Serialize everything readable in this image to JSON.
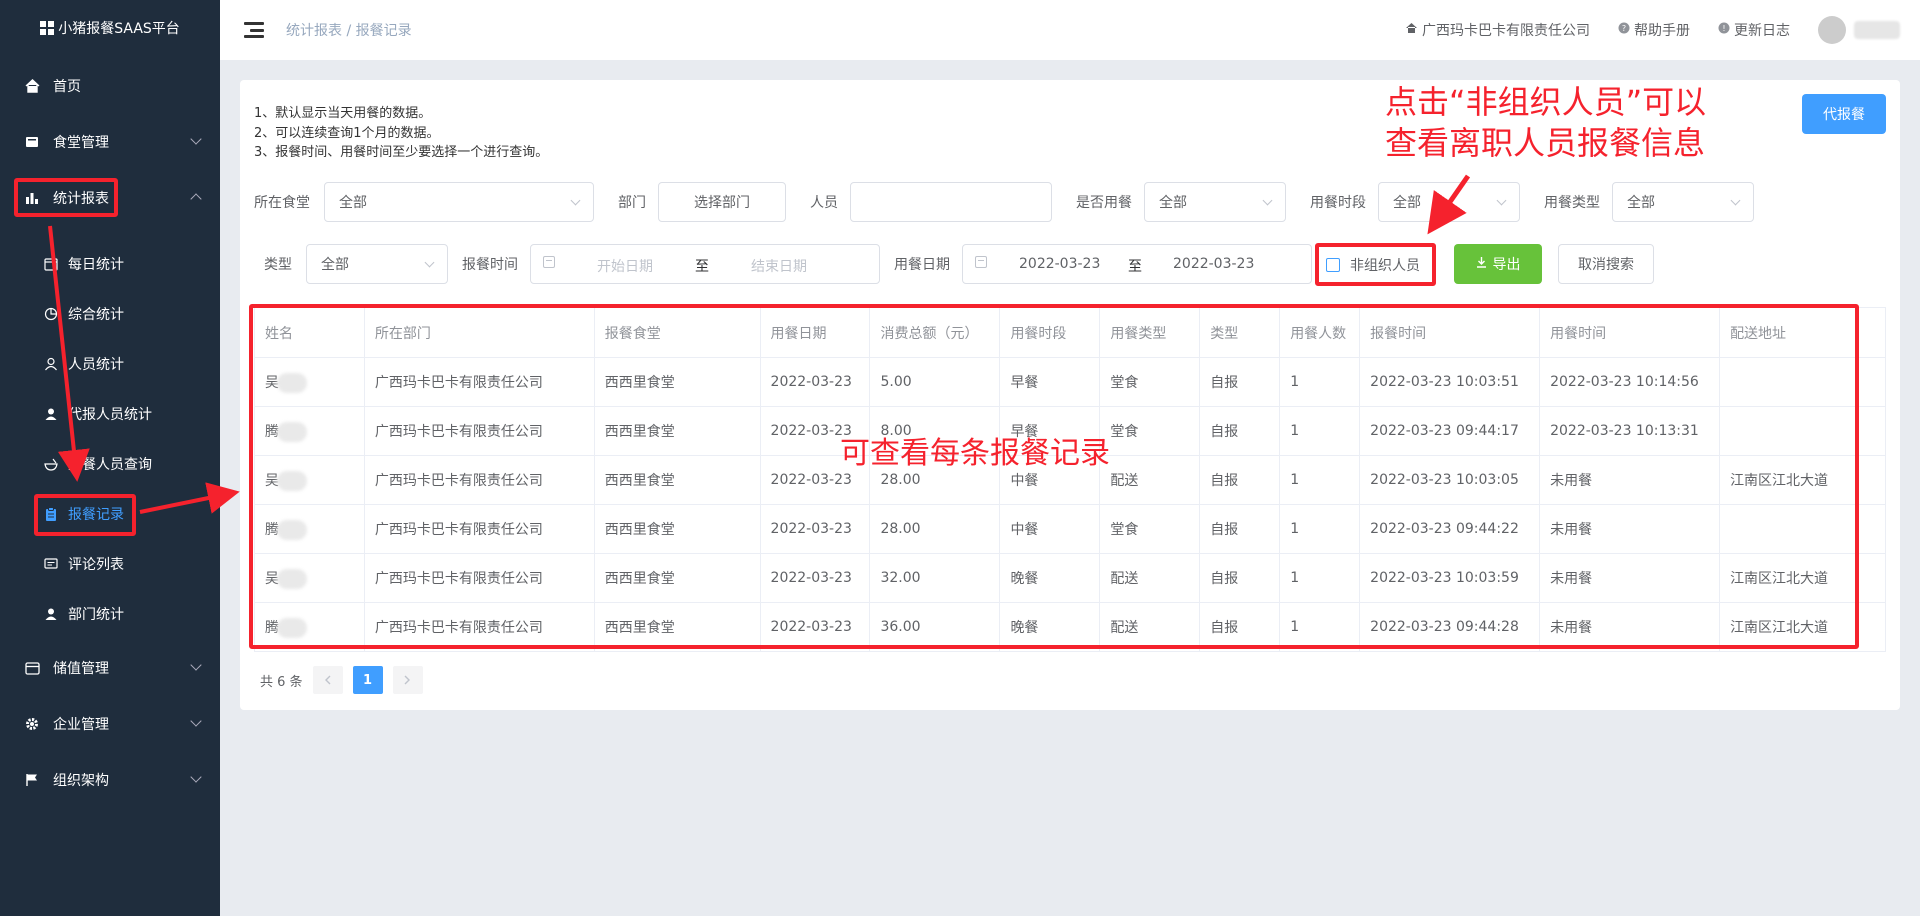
{
  "app": {
    "title": "小猪报餐SAAS平台"
  },
  "sidebar": {
    "items": [
      {
        "label": "首页",
        "icon": "home-icon"
      },
      {
        "label": "食堂管理",
        "icon": "canteen-icon"
      },
      {
        "label": "统计报表",
        "icon": "bar-chart-icon",
        "expanded": true
      },
      {
        "label": "储值管理",
        "icon": "wallet-icon"
      },
      {
        "label": "企业管理",
        "icon": "gear-icon"
      },
      {
        "label": "组织架构",
        "icon": "flag-icon"
      }
    ],
    "sub_items": [
      {
        "label": "每日统计",
        "icon": "calendar-icon"
      },
      {
        "label": "综合统计",
        "icon": "pie-icon"
      },
      {
        "label": "人员统计",
        "icon": "user-icon"
      },
      {
        "label": "代报人员统计",
        "icon": "user-filled-icon"
      },
      {
        "label": "报餐人员查询",
        "icon": "bowl-icon"
      },
      {
        "label": "报餐记录",
        "icon": "clipboard-icon",
        "active": true
      },
      {
        "label": "评论列表",
        "icon": "comment-icon"
      },
      {
        "label": "部门统计",
        "icon": "user-filled-icon"
      }
    ]
  },
  "header": {
    "breadcrumb": "统计报表 / 报餐记录",
    "company": "广西玛卡巴卡有限责任公司",
    "help": "帮助手册",
    "changelog": "更新日志"
  },
  "notes": [
    "1、默认显示当天用餐的数据。",
    "2、可以连续查询1个月的数据。",
    "3、报餐时间、用餐时间至少要选择一个进行查询。"
  ],
  "actions": {
    "proxy_order": "代报餐",
    "export": "导出",
    "cancel_search": "取消搜索"
  },
  "filters": {
    "canteen_label": "所在食堂",
    "canteen_value": "全部",
    "dept_label": "部门",
    "dept_button": "选择部门",
    "person_label": "人员",
    "used_label": "是否用餐",
    "used_value": "全部",
    "period_label": "用餐时段",
    "period_value": "全部",
    "mealtype_label": "用餐类型",
    "mealtype_value": "全部",
    "type_label": "类型",
    "type_value": "全部",
    "order_time_label": "报餐时间",
    "order_start_placeholder": "开始日期",
    "order_sep": "至",
    "order_end_placeholder": "结束日期",
    "meal_date_label": "用餐日期",
    "meal_start": "2022-03-23",
    "meal_sep": "至",
    "meal_end": "2022-03-23",
    "non_org_label": "非组织人员"
  },
  "table": {
    "columns": [
      "姓名",
      "所在部门",
      "报餐食堂",
      "用餐日期",
      "消费总额（元）",
      "用餐时段",
      "用餐类型",
      "类型",
      "用餐人数",
      "报餐时间",
      "用餐时间",
      "配送地址"
    ],
    "rows": [
      [
        "吴",
        "广西玛卡巴卡有限责任公司",
        "西西里食堂",
        "2022-03-23",
        "5.00",
        "早餐",
        "堂食",
        "自报",
        "1",
        "2022-03-23 10:03:51",
        "2022-03-23 10:14:56",
        ""
      ],
      [
        "腾",
        "广西玛卡巴卡有限责任公司",
        "西西里食堂",
        "2022-03-23",
        "8.00",
        "早餐",
        "堂食",
        "自报",
        "1",
        "2022-03-23 09:44:17",
        "2022-03-23 10:13:31",
        ""
      ],
      [
        "吴",
        "广西玛卡巴卡有限责任公司",
        "西西里食堂",
        "2022-03-23",
        "28.00",
        "中餐",
        "配送",
        "自报",
        "1",
        "2022-03-23 10:03:05",
        "未用餐",
        "江南区江北大道"
      ],
      [
        "腾",
        "广西玛卡巴卡有限责任公司",
        "西西里食堂",
        "2022-03-23",
        "28.00",
        "中餐",
        "堂食",
        "自报",
        "1",
        "2022-03-23 09:44:22",
        "未用餐",
        ""
      ],
      [
        "吴",
        "广西玛卡巴卡有限责任公司",
        "西西里食堂",
        "2022-03-23",
        "32.00",
        "晚餐",
        "配送",
        "自报",
        "1",
        "2022-03-23 10:03:59",
        "未用餐",
        "江南区江北大道"
      ],
      [
        "腾",
        "广西玛卡巴卡有限责任公司",
        "西西里食堂",
        "2022-03-23",
        "36.00",
        "晚餐",
        "配送",
        "自报",
        "1",
        "2022-03-23 09:44:28",
        "未用餐",
        "江南区江北大道"
      ]
    ]
  },
  "pagination": {
    "total": "共 6 条",
    "current": "1"
  },
  "annotations": {
    "top_line1": "点击“非组织人员”可以",
    "top_line2": "查看离职人员报餐信息",
    "middle": "可查看每条报餐记录"
  },
  "colors": {
    "sidebar_bg": "#1f2d3d",
    "primary": "#409eff",
    "success": "#67c23a",
    "annotation": "#f5222d"
  }
}
